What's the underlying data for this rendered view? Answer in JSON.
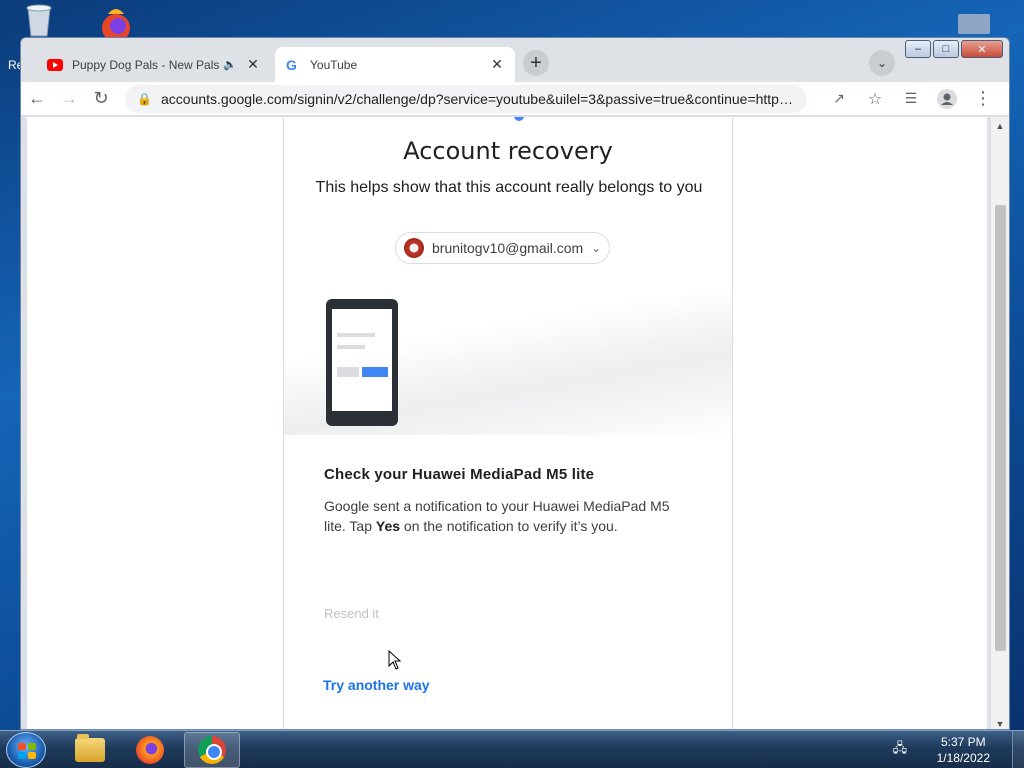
{
  "desktop": {
    "partial_label_left": "Re"
  },
  "browser": {
    "tabs": [
      {
        "title": "Puppy Dog Pals - New Pals o",
        "favicon": "youtube-icon",
        "audio": true
      },
      {
        "title": "YouTube",
        "favicon": "google-icon",
        "active": true
      }
    ],
    "address_bar": {
      "url": "accounts.google.com/signin/v2/challenge/dp?service=youtube&uilel=3&passive=true&continue=https..."
    }
  },
  "page": {
    "heading": "Account recovery",
    "subtitle": "This helps show that this account really belongs to you",
    "account_email": "brunitogv10@gmail.com",
    "device_title": "Check your Huawei MediaPad M5 lite",
    "message_before": "Google sent a notification to your Huawei MediaPad M5 lite. Tap ",
    "message_bold": "Yes",
    "message_after": " on the notification to verify it’s you.",
    "resend_label": "Resend it",
    "try_another_label": "Try another way"
  },
  "taskbar": {
    "time": "5:37 PM",
    "date": "1/18/2022"
  },
  "colors": {
    "link_blue": "#1a73e8",
    "google_blue": "#4285f4"
  }
}
